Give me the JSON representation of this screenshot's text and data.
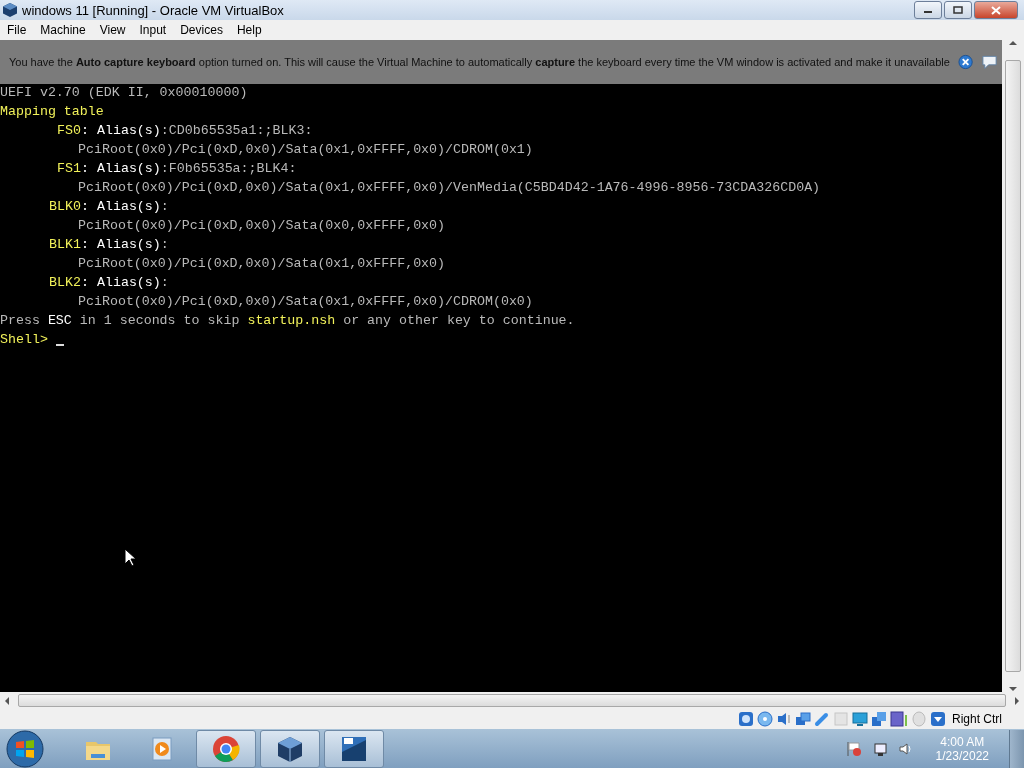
{
  "window": {
    "title": "windows 11 [Running] - Oracle VM VirtualBox"
  },
  "menu": [
    "File",
    "Machine",
    "View",
    "Input",
    "Devices",
    "Help"
  ],
  "banner": {
    "text": "You have the **Auto capture keyboard** option turned on. This will cause the Virtual Machine to automatically **capture** the keyboard every time the VM window is activated and make it unavailable"
  },
  "console": {
    "version_line": "UEFI v2.70 (EDK II, 0x00010000)",
    "mapping_title": "Mapping table",
    "mappings": [
      {
        "name": "FS0",
        "alias_label": ": Alias(s)",
        "alias": ":CD0b65535a1:;BLK3:",
        "path": "PciRoot(0x0)/Pci(0xD,0x0)/Sata(0x1,0xFFFF,0x0)/CDROM(0x1)"
      },
      {
        "name": "FS1",
        "alias_label": ": Alias(s)",
        "alias": ":F0b65535a:;BLK4:",
        "path": "PciRoot(0x0)/Pci(0xD,0x0)/Sata(0x1,0xFFFF,0x0)/VenMedia(C5BD4D42-1A76-4996-8956-73CDA326CD0A)"
      },
      {
        "name": "BLK0",
        "alias_label": ": Alias(s)",
        "alias": ":",
        "path": "PciRoot(0x0)/Pci(0xD,0x0)/Sata(0x0,0xFFFF,0x0)"
      },
      {
        "name": "BLK1",
        "alias_label": ": Alias(s)",
        "alias": ":",
        "path": "PciRoot(0x0)/Pci(0xD,0x0)/Sata(0x1,0xFFFF,0x0)"
      },
      {
        "name": "BLK2",
        "alias_label": ": Alias(s)",
        "alias": ":",
        "path": "PciRoot(0x0)/Pci(0xD,0x0)/Sata(0x1,0xFFFF,0x0)/CDROM(0x0)"
      }
    ],
    "message": [
      {
        "kind": "plain",
        "text": "Press "
      },
      {
        "kind": "key",
        "text": "ESC"
      },
      {
        "kind": "plain",
        "text": " in 1 seconds to skip "
      },
      {
        "kind": "file",
        "text": "startup.nsh"
      },
      {
        "kind": "plain",
        "text": " or any other key to continue."
      }
    ],
    "prompt": "Shell>"
  },
  "status_bar": {
    "host_key": "Right Ctrl"
  },
  "taskbar": {
    "apps": [
      {
        "kind": "folder",
        "running": false
      },
      {
        "kind": "media",
        "running": false
      },
      {
        "kind": "browser",
        "running": true
      },
      {
        "kind": "cube",
        "running": true
      },
      {
        "kind": "os",
        "running": true
      }
    ],
    "time": "4:00 AM",
    "date": "1/23/2022"
  }
}
